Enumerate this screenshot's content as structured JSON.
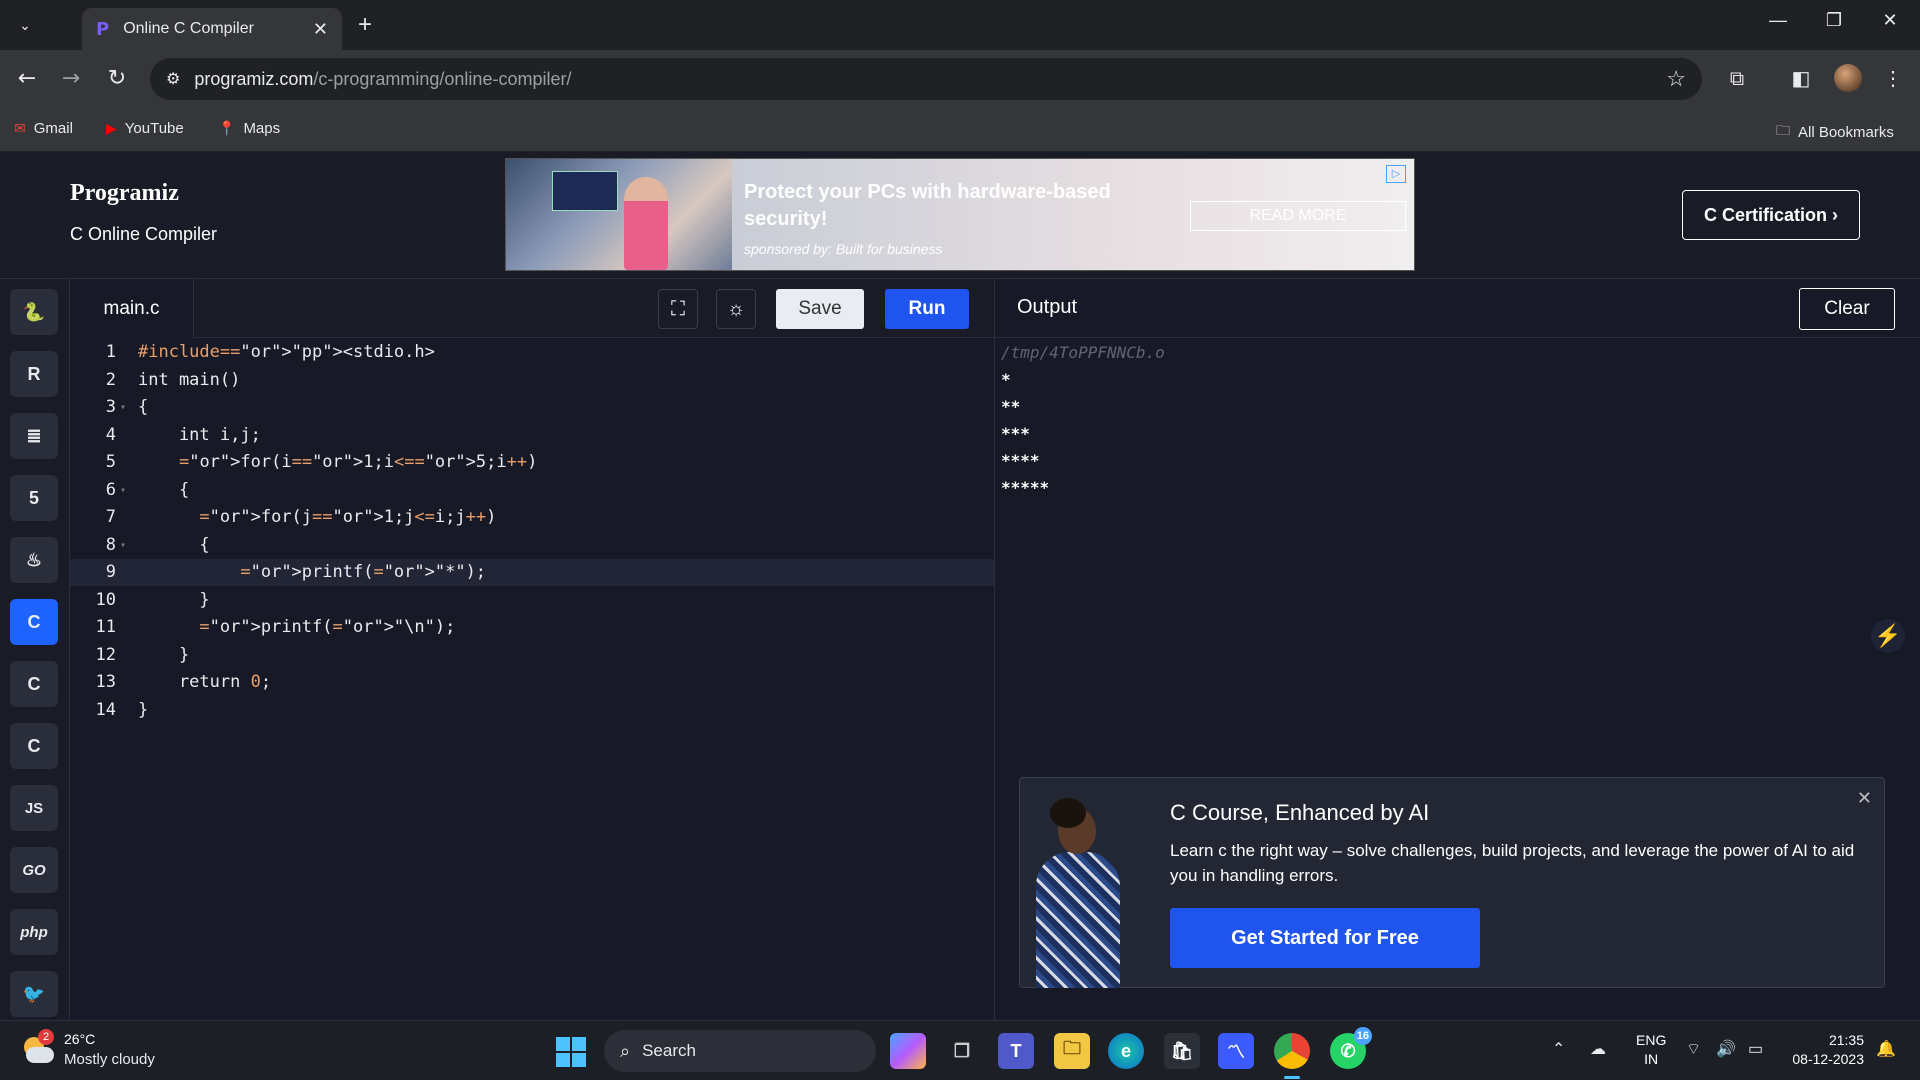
{
  "browser": {
    "tab_title": "Online C Compiler",
    "url_host": "programiz.com",
    "url_path": "/c-programming/online-compiler/",
    "bookmarks": [
      {
        "label": "Gmail",
        "icon": "gmail-icon"
      },
      {
        "label": "YouTube",
        "icon": "youtube-icon"
      },
      {
        "label": "Maps",
        "icon": "maps-icon"
      }
    ],
    "all_bookmarks": "All Bookmarks"
  },
  "header": {
    "logo": "Programiz",
    "subtitle": "C Online Compiler",
    "certification_button": "C Certification ›"
  },
  "ad": {
    "headline": "Protect your PCs with hardware-based security!",
    "sponsor": "sponsored by: Built for business",
    "button": "READ MORE"
  },
  "sidebar": {
    "languages": [
      {
        "name": "python",
        "glyph": "🐍"
      },
      {
        "name": "r",
        "glyph": "R"
      },
      {
        "name": "sql",
        "glyph": "≣"
      },
      {
        "name": "html",
        "glyph": "5"
      },
      {
        "name": "java",
        "glyph": "♨"
      },
      {
        "name": "c",
        "glyph": "C",
        "active": true
      },
      {
        "name": "cpp",
        "glyph": "C"
      },
      {
        "name": "csharp",
        "glyph": "C"
      },
      {
        "name": "javascript",
        "glyph": "JS"
      },
      {
        "name": "go",
        "glyph": "GO"
      },
      {
        "name": "php",
        "glyph": "php"
      },
      {
        "name": "swift",
        "glyph": "🐦"
      }
    ]
  },
  "editor": {
    "filename": "main.c",
    "save_label": "Save",
    "run_label": "Run",
    "lines": [
      "#include<stdio.h>",
      "int main()",
      "{",
      "    int i,j;",
      "    for(i=1;i<=5;i++)",
      "    {",
      "      for(j=1;j<=i;j++)",
      "      {",
      "          printf(\"*\");",
      "      }",
      "      printf(\"\\n\");",
      "    }",
      "    return 0;",
      "}"
    ],
    "highlighted_line": 9
  },
  "output": {
    "title": "Output",
    "clear_label": "Clear",
    "path": "/tmp/4ToPPFNNCb.o",
    "lines": [
      "*",
      "**",
      "***",
      "****",
      "*****"
    ]
  },
  "promo": {
    "title": "C Course, Enhanced by AI",
    "text": "Learn c the right way – solve challenges, build projects, and leverage the power of AI to aid you in handling errors.",
    "cta": "Get Started for Free"
  },
  "taskbar": {
    "weather_temp": "26°C",
    "weather_desc": "Mostly cloudy",
    "weather_badge": "2",
    "search_placeholder": "Search",
    "whatsapp_badge": "16",
    "lang_line1": "ENG",
    "lang_line2": "IN",
    "time": "21:35",
    "date": "08-12-2023"
  }
}
